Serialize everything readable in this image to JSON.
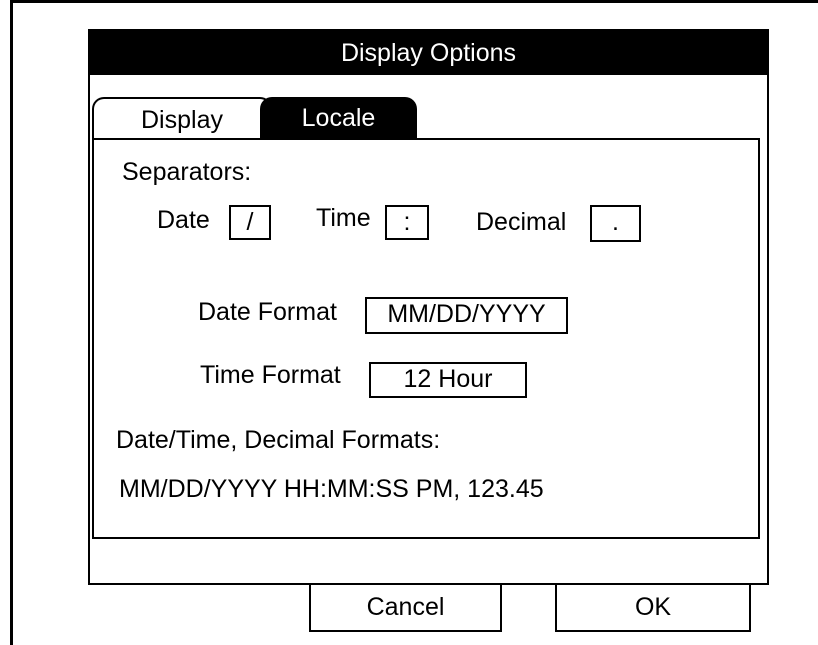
{
  "dialog": {
    "title": "Display Options"
  },
  "tabs": [
    {
      "label": "Display",
      "active": false
    },
    {
      "label": "Locale",
      "active": true
    }
  ],
  "locale": {
    "separators_label": "Separators:",
    "date_label": "Date",
    "date_separator": "/",
    "time_label": "Time",
    "time_separator": ":",
    "decimal_label": "Decimal",
    "decimal_separator": ".",
    "date_format_label": "Date Format",
    "date_format_value": "MM/DD/YYYY",
    "time_format_label": "Time Format",
    "time_format_value": "12 Hour",
    "preview_label": "Date/Time, Decimal Formats:",
    "preview_value": "MM/DD/YYYY HH:MM:SS PM, 123.45"
  },
  "buttons": {
    "cancel": "Cancel",
    "ok": "OK"
  }
}
